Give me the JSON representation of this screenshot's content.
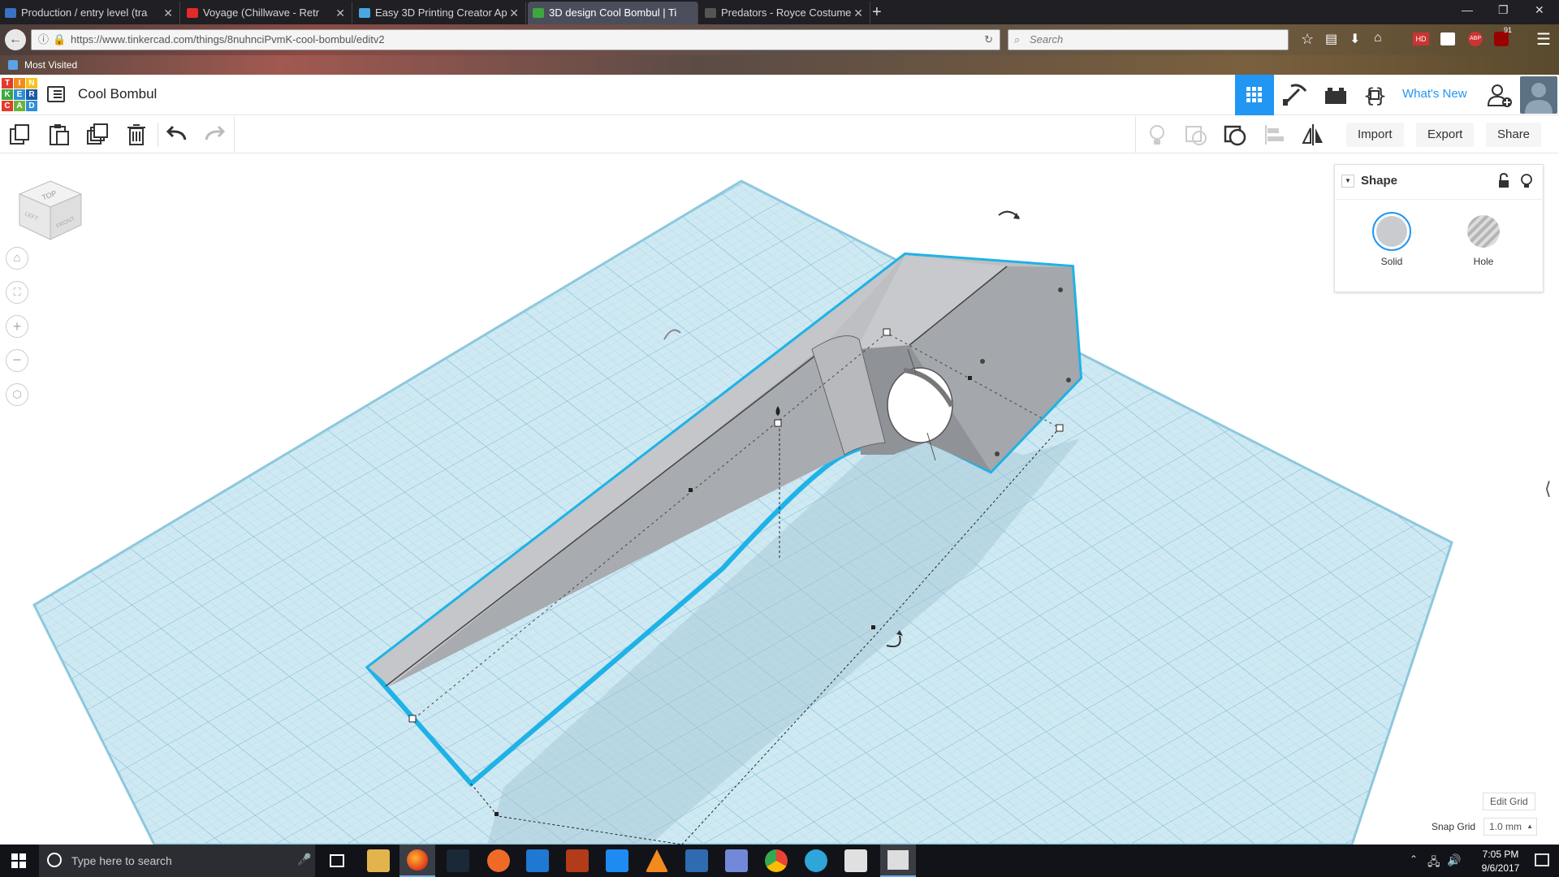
{
  "browser": {
    "tabs": [
      {
        "label": "Production / entry level (tra",
        "icon_color": "#3a72c5"
      },
      {
        "label": "Voyage (Chillwave - Retr",
        "icon_color": "#e22a2a"
      },
      {
        "label": "Easy 3D Printing Creator Ap",
        "icon_color": "#4aa6e0"
      },
      {
        "label": "3D design Cool Bombul | Ti",
        "icon_color": "#3fa63f"
      },
      {
        "label": "Predators - Royce Costume",
        "icon_color": "#555555"
      }
    ],
    "new_tab_label": "+",
    "url": "https://www.tinkercad.com/things/8nuhnciPvmK-cool-bombul/editv2",
    "search_placeholder": "Search",
    "bookmarks_label": "Most Visited",
    "badge_count": "91"
  },
  "app": {
    "logo_letters": [
      "T",
      "I",
      "N",
      "K",
      "E",
      "R",
      "C",
      "A",
      "D"
    ],
    "logo_colors": [
      "#e23b2a",
      "#f28a1e",
      "#f7c21c",
      "#3aa93f",
      "#2f8fd4",
      "#1f5aa8",
      "#e23b2a",
      "#6ab33f",
      "#2f8fd4"
    ],
    "design_title": "Cool Bombul",
    "whats_new": "What's New",
    "toolbar": {
      "import_label": "Import",
      "export_label": "Export",
      "share_label": "Share"
    }
  },
  "shape_panel": {
    "title": "Shape",
    "solid_label": "Solid",
    "hole_label": "Hole"
  },
  "viewcube": {
    "top": "TOP",
    "left": "LEFT",
    "front": "FRONT"
  },
  "grid_controls": {
    "edit_grid_label": "Edit Grid",
    "snap_grid_label": "Snap Grid",
    "snap_value": "1.0 mm"
  },
  "taskbar": {
    "search_placeholder": "Type here to search",
    "time": "7:05 PM",
    "date": "9/6/2017"
  },
  "colors": {
    "accent_blue": "#2196f3",
    "workplane": "#cfe9f3",
    "selection_outline": "#1fb2e6"
  }
}
